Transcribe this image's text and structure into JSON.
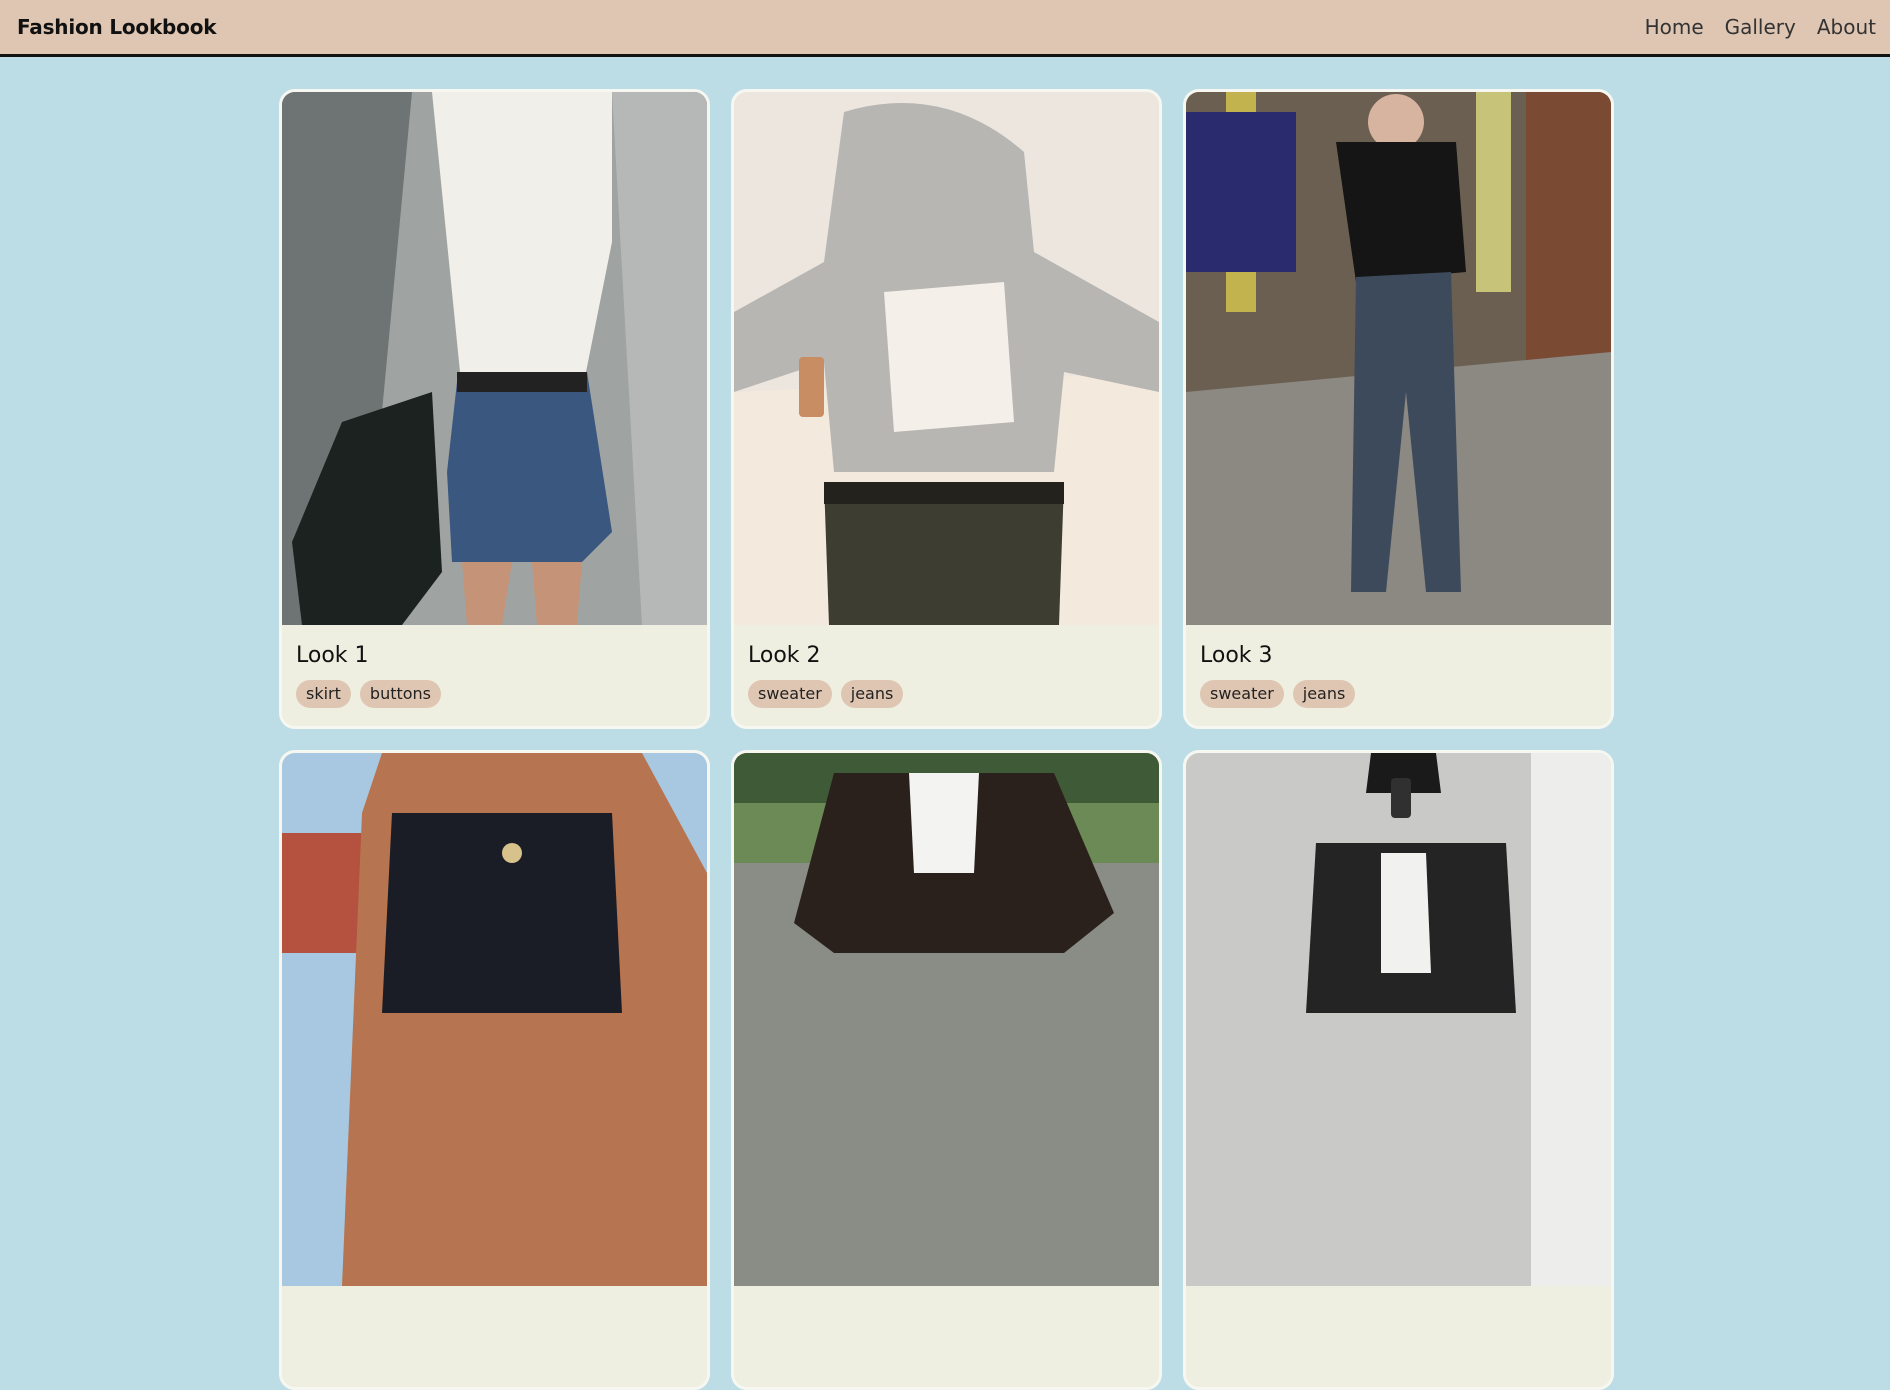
{
  "header": {
    "brand": "Fashion Lookbook",
    "nav": [
      "Home",
      "Gallery",
      "About"
    ]
  },
  "colors": {
    "page_bg": "#bcdde6",
    "nav_bg": "#dfc6b2",
    "card_bg": "#eeefe1",
    "tag_bg": "#dfc6b2"
  },
  "looks": [
    {
      "title": "Look 1",
      "tags": [
        "skirt",
        "buttons"
      ]
    },
    {
      "title": "Look 2",
      "tags": [
        "sweater",
        "jeans"
      ]
    },
    {
      "title": "Look 3",
      "tags": [
        "sweater",
        "jeans"
      ]
    },
    {
      "title": "",
      "tags": []
    },
    {
      "title": "",
      "tags": []
    },
    {
      "title": "",
      "tags": []
    }
  ]
}
